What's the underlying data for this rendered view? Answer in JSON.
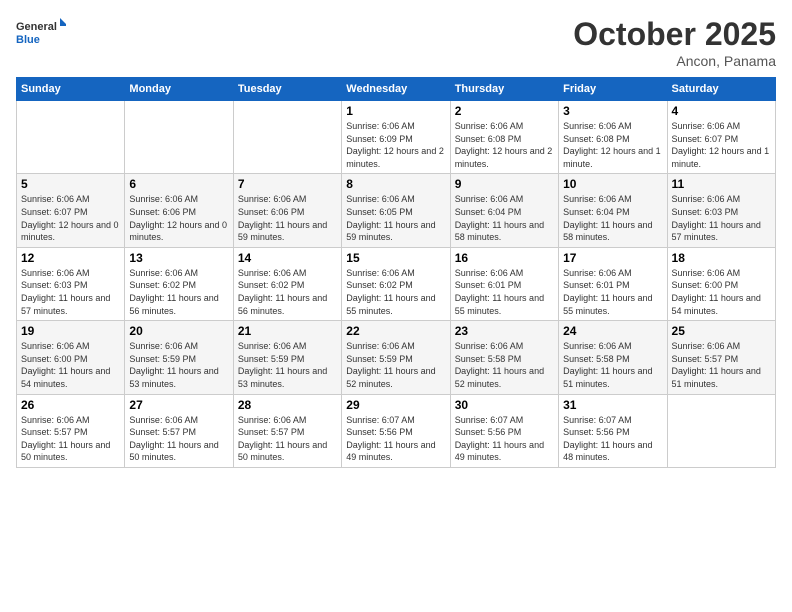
{
  "header": {
    "logo_general": "General",
    "logo_blue": "Blue",
    "month_title": "October 2025",
    "location": "Ancon, Panama"
  },
  "weekdays": [
    "Sunday",
    "Monday",
    "Tuesday",
    "Wednesday",
    "Thursday",
    "Friday",
    "Saturday"
  ],
  "weeks": [
    [
      {
        "day": "",
        "info": ""
      },
      {
        "day": "",
        "info": ""
      },
      {
        "day": "",
        "info": ""
      },
      {
        "day": "1",
        "info": "Sunrise: 6:06 AM\nSunset: 6:09 PM\nDaylight: 12 hours and 2 minutes."
      },
      {
        "day": "2",
        "info": "Sunrise: 6:06 AM\nSunset: 6:08 PM\nDaylight: 12 hours and 2 minutes."
      },
      {
        "day": "3",
        "info": "Sunrise: 6:06 AM\nSunset: 6:08 PM\nDaylight: 12 hours and 1 minute."
      },
      {
        "day": "4",
        "info": "Sunrise: 6:06 AM\nSunset: 6:07 PM\nDaylight: 12 hours and 1 minute."
      }
    ],
    [
      {
        "day": "5",
        "info": "Sunrise: 6:06 AM\nSunset: 6:07 PM\nDaylight: 12 hours and 0 minutes."
      },
      {
        "day": "6",
        "info": "Sunrise: 6:06 AM\nSunset: 6:06 PM\nDaylight: 12 hours and 0 minutes."
      },
      {
        "day": "7",
        "info": "Sunrise: 6:06 AM\nSunset: 6:06 PM\nDaylight: 11 hours and 59 minutes."
      },
      {
        "day": "8",
        "info": "Sunrise: 6:06 AM\nSunset: 6:05 PM\nDaylight: 11 hours and 59 minutes."
      },
      {
        "day": "9",
        "info": "Sunrise: 6:06 AM\nSunset: 6:04 PM\nDaylight: 11 hours and 58 minutes."
      },
      {
        "day": "10",
        "info": "Sunrise: 6:06 AM\nSunset: 6:04 PM\nDaylight: 11 hours and 58 minutes."
      },
      {
        "day": "11",
        "info": "Sunrise: 6:06 AM\nSunset: 6:03 PM\nDaylight: 11 hours and 57 minutes."
      }
    ],
    [
      {
        "day": "12",
        "info": "Sunrise: 6:06 AM\nSunset: 6:03 PM\nDaylight: 11 hours and 57 minutes."
      },
      {
        "day": "13",
        "info": "Sunrise: 6:06 AM\nSunset: 6:02 PM\nDaylight: 11 hours and 56 minutes."
      },
      {
        "day": "14",
        "info": "Sunrise: 6:06 AM\nSunset: 6:02 PM\nDaylight: 11 hours and 56 minutes."
      },
      {
        "day": "15",
        "info": "Sunrise: 6:06 AM\nSunset: 6:02 PM\nDaylight: 11 hours and 55 minutes."
      },
      {
        "day": "16",
        "info": "Sunrise: 6:06 AM\nSunset: 6:01 PM\nDaylight: 11 hours and 55 minutes."
      },
      {
        "day": "17",
        "info": "Sunrise: 6:06 AM\nSunset: 6:01 PM\nDaylight: 11 hours and 55 minutes."
      },
      {
        "day": "18",
        "info": "Sunrise: 6:06 AM\nSunset: 6:00 PM\nDaylight: 11 hours and 54 minutes."
      }
    ],
    [
      {
        "day": "19",
        "info": "Sunrise: 6:06 AM\nSunset: 6:00 PM\nDaylight: 11 hours and 54 minutes."
      },
      {
        "day": "20",
        "info": "Sunrise: 6:06 AM\nSunset: 5:59 PM\nDaylight: 11 hours and 53 minutes."
      },
      {
        "day": "21",
        "info": "Sunrise: 6:06 AM\nSunset: 5:59 PM\nDaylight: 11 hours and 53 minutes."
      },
      {
        "day": "22",
        "info": "Sunrise: 6:06 AM\nSunset: 5:59 PM\nDaylight: 11 hours and 52 minutes."
      },
      {
        "day": "23",
        "info": "Sunrise: 6:06 AM\nSunset: 5:58 PM\nDaylight: 11 hours and 52 minutes."
      },
      {
        "day": "24",
        "info": "Sunrise: 6:06 AM\nSunset: 5:58 PM\nDaylight: 11 hours and 51 minutes."
      },
      {
        "day": "25",
        "info": "Sunrise: 6:06 AM\nSunset: 5:57 PM\nDaylight: 11 hours and 51 minutes."
      }
    ],
    [
      {
        "day": "26",
        "info": "Sunrise: 6:06 AM\nSunset: 5:57 PM\nDaylight: 11 hours and 50 minutes."
      },
      {
        "day": "27",
        "info": "Sunrise: 6:06 AM\nSunset: 5:57 PM\nDaylight: 11 hours and 50 minutes."
      },
      {
        "day": "28",
        "info": "Sunrise: 6:06 AM\nSunset: 5:57 PM\nDaylight: 11 hours and 50 minutes."
      },
      {
        "day": "29",
        "info": "Sunrise: 6:07 AM\nSunset: 5:56 PM\nDaylight: 11 hours and 49 minutes."
      },
      {
        "day": "30",
        "info": "Sunrise: 6:07 AM\nSunset: 5:56 PM\nDaylight: 11 hours and 49 minutes."
      },
      {
        "day": "31",
        "info": "Sunrise: 6:07 AM\nSunset: 5:56 PM\nDaylight: 11 hours and 48 minutes."
      },
      {
        "day": "",
        "info": ""
      }
    ]
  ]
}
